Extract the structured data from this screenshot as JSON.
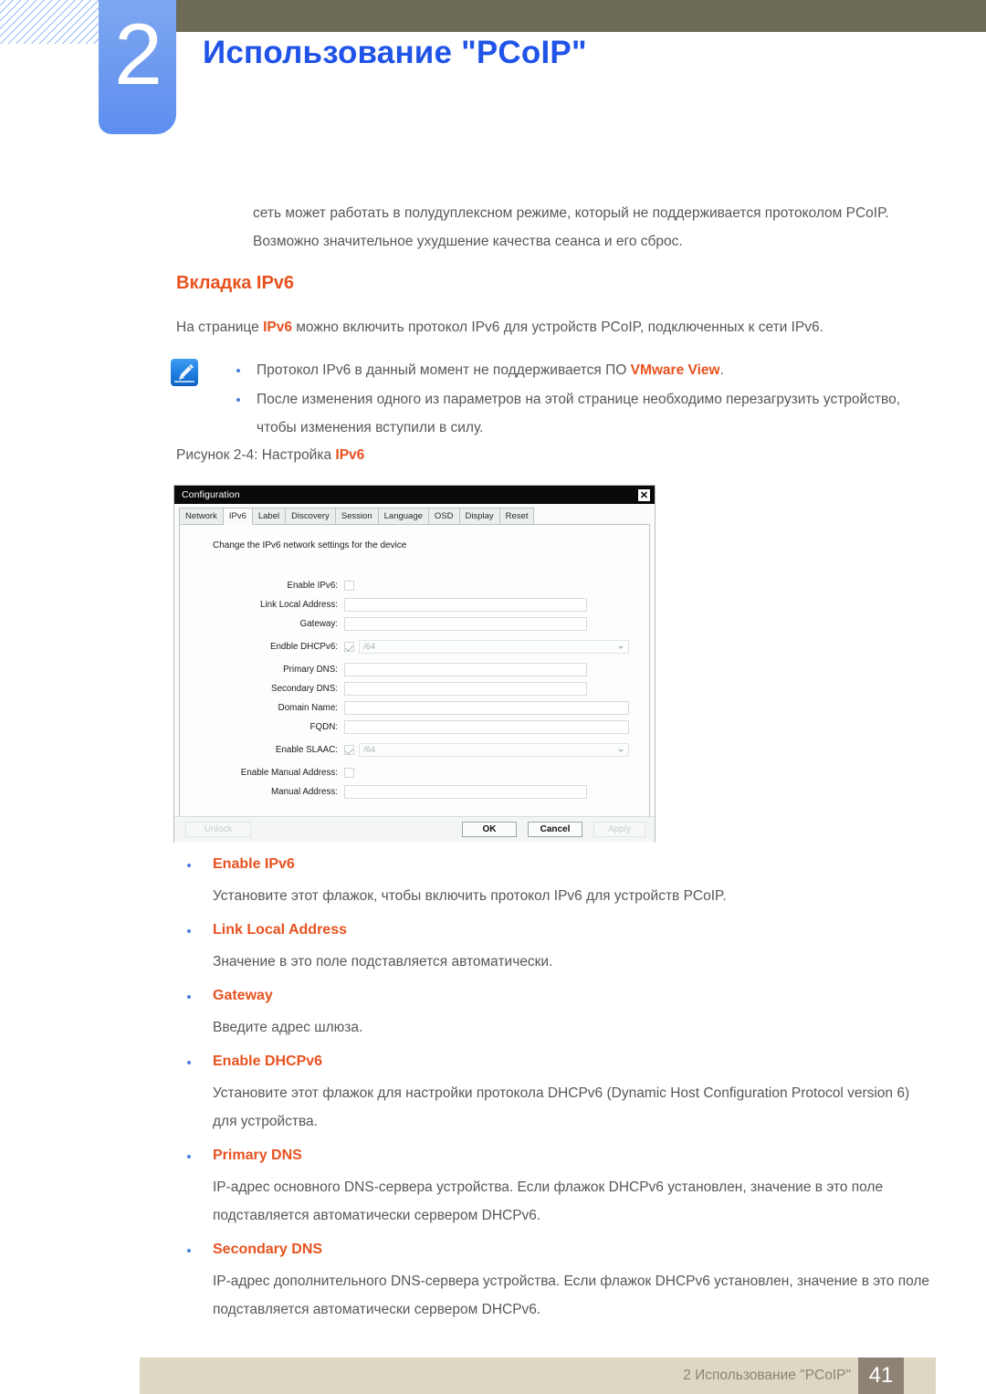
{
  "header": {
    "chapter_number": "2",
    "chapter_title": "Использование \"PCoIP\"",
    "accent_blue": "#2054e8",
    "olive": "#6b6b56"
  },
  "body": {
    "intro_paragraph": "сеть может работать в полудуплексном режиме, который не поддерживается протоколом PCoIP. Возможно значительное ухудшение качества сеанса и его сброс.",
    "section_heading": "Вкладка IPv6",
    "lead_prefix": "На странице ",
    "lead_highlight": "IPv6",
    "lead_suffix": " можно включить протокол IPv6 для устройств PCoIP, подключенных к сети IPv6.",
    "accent_orange": "#e8521f"
  },
  "note": {
    "icon": "note-pen-icon",
    "items": [
      {
        "prefix": "Протокол IPv6 в данный момент не поддерживается ПО ",
        "highlight": "VMware View",
        "suffix": "."
      },
      {
        "prefix": "После изменения одного из параметров на этой странице необходимо перезагрузить устройство, чтобы изменения вступили в силу.",
        "highlight": "",
        "suffix": ""
      }
    ]
  },
  "figure": {
    "caption_prefix": "Рисунок 2-4: Настройка ",
    "caption_highlight": "IPv6"
  },
  "dialog": {
    "title": "Configuration",
    "close_label": "✕",
    "tabs": [
      {
        "label": "Network",
        "active": false
      },
      {
        "label": "IPv6",
        "active": true
      },
      {
        "label": "Label",
        "active": false
      },
      {
        "label": "Discovery",
        "active": false
      },
      {
        "label": "Session",
        "active": false
      },
      {
        "label": "Language",
        "active": false
      },
      {
        "label": "OSD",
        "active": false
      },
      {
        "label": "Display",
        "active": false
      },
      {
        "label": "Reset",
        "active": false
      }
    ],
    "panel_description": "Change the IPv6 network settings for the device",
    "fields": [
      {
        "label": "Enable IPv6:",
        "type": "checkbox",
        "checked": false,
        "value": ""
      },
      {
        "label": "Link Local Address:",
        "type": "text",
        "value": ""
      },
      {
        "label": "Gateway:",
        "type": "text",
        "value": ""
      },
      {
        "label": "Endble DHCPv6:",
        "type": "checkbox-combo",
        "checked": true,
        "value": "/64"
      },
      {
        "label": "Primary DNS:",
        "type": "text",
        "value": ""
      },
      {
        "label": "Secondary DNS:",
        "type": "text",
        "value": ""
      },
      {
        "label": "Domain Name:",
        "type": "text-long",
        "value": ""
      },
      {
        "label": "FQDN:",
        "type": "text-long",
        "value": ""
      },
      {
        "label": "Enable SLAAC:",
        "type": "checkbox-combo",
        "checked": true,
        "value": "/64"
      },
      {
        "label": "Enable Manual Address:",
        "type": "checkbox",
        "checked": false,
        "value": ""
      },
      {
        "label": "Manual Address:",
        "type": "text",
        "value": ""
      }
    ],
    "buttons": {
      "unlock": "Unlock",
      "ok": "OK",
      "cancel": "Cancel",
      "apply": "Apply"
    }
  },
  "definitions": [
    {
      "term": "Enable IPv6",
      "description": "Установите этот флажок, чтобы включить протокол IPv6 для устройств PCoIP."
    },
    {
      "term": "Link Local Address",
      "description": "Значение в это поле подставляется автоматически."
    },
    {
      "term": "Gateway",
      "description": "Введите адрес шлюза."
    },
    {
      "term": "Enable DHCPv6",
      "description": "Установите этот флажок для настройки протокола DHCPv6 (Dynamic Host Configuration Protocol version 6) для устройства."
    },
    {
      "term": "Primary DNS",
      "description": "IP-адрес основного DNS-сервера устройства. Если флажок DHCPv6 установлен, значение в это поле подставляется автоматически сервером DHCPv6."
    },
    {
      "term": "Secondary DNS",
      "description": "IP-адрес дополнительного DNS-сервера устройства. Если флажок DHCPv6 установлен, значение в это поле подставляется автоматически сервером DHCPv6."
    }
  ],
  "footer": {
    "text": "2 Использование \"PCoIP\"",
    "page_number": "41"
  }
}
